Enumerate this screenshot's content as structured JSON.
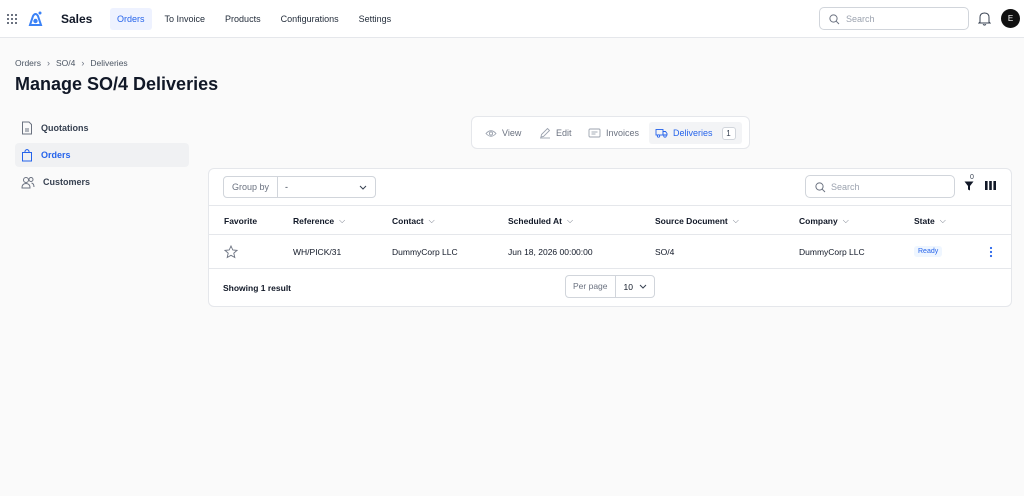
{
  "app": {
    "name": "Sales",
    "user_initial": "E"
  },
  "nav": [
    {
      "label": "Orders",
      "active": true
    },
    {
      "label": "To Invoice",
      "active": false
    },
    {
      "label": "Products",
      "active": false
    },
    {
      "label": "Configurations",
      "active": false
    },
    {
      "label": "Settings",
      "active": false
    }
  ],
  "search": {
    "placeholder": "Search"
  },
  "breadcrumb": [
    "Orders",
    "SO/4",
    "Deliveries"
  ],
  "page_title": "Manage SO/4 Deliveries",
  "sidebar": {
    "items": [
      {
        "label": "Quotations",
        "icon": "document-icon",
        "active": false
      },
      {
        "label": "Orders",
        "icon": "shopping-bag-icon",
        "active": true
      },
      {
        "label": "Customers",
        "icon": "users-icon",
        "active": false
      }
    ]
  },
  "tabs": [
    {
      "label": "View",
      "icon": "eye-icon"
    },
    {
      "label": "Edit",
      "icon": "pencil-icon"
    },
    {
      "label": "Invoices",
      "icon": "invoice-icon"
    },
    {
      "label": "Deliveries",
      "icon": "truck-icon",
      "count": "1",
      "active": true
    }
  ],
  "toolbar": {
    "group_by_label": "Group by",
    "group_by_value": "-",
    "search_placeholder": "Search",
    "filter_count": "0"
  },
  "table": {
    "columns": [
      "Favorite",
      "Reference",
      "Contact",
      "Scheduled At",
      "Source Document",
      "Company",
      "State"
    ],
    "rows": [
      {
        "reference": "WH/PICK/31",
        "contact": "DummyCorp LLC",
        "scheduled_at": "Jun 18, 2026 00:00:00",
        "source_document": "SO/4",
        "company": "DummyCorp LLC",
        "state": "Ready"
      }
    ]
  },
  "footer": {
    "result_text": "Showing 1 result",
    "per_page_label": "Per page",
    "per_page_value": "10"
  },
  "colors": {
    "accent": "#2563eb",
    "badge_bg": "#eff6ff"
  }
}
